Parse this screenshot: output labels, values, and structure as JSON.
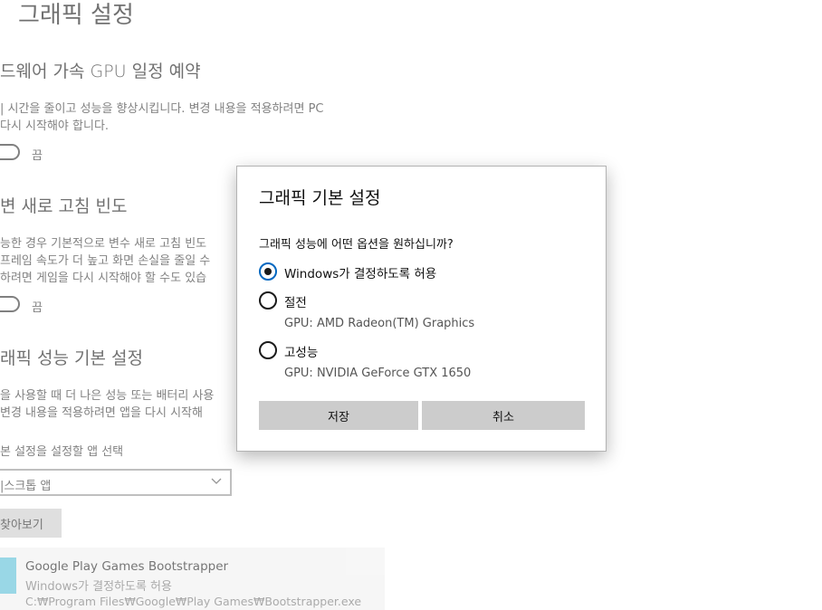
{
  "background": {
    "page_title": "그래픽 설정",
    "hw_section": {
      "title": "드웨어 가속 GPU 일정 예약",
      "desc_line1": "| 시간을 줄이고 성능을 향상시킵니다. 변경 내용을 적용하려면 PC",
      "desc_line2": "다시 시작해야 합니다.",
      "toggle_label": "끔"
    },
    "vrr_section": {
      "title": "변 새로 고침 빈도",
      "desc_line1": "능한 경우 기본적으로 변수 새로 고침 빈도",
      "desc_line2": "프레임 속도가 더 높고 화면 손실을 줄일 수",
      "desc_line3": "하려면 게임을 다시 시작해야 할 수도 있습",
      "toggle_label": "끔"
    },
    "perf_section": {
      "title": "래픽 성능 기본 설정",
      "desc_line1": "을 사용할 때 더 나은 성능 또는 배터리 사용",
      "desc_line2": "변경 내용을 적용하려면 앱을 다시 시작해"
    },
    "app_select_label": "본 설정을 설정할 앱 선택",
    "dropdown_value": "|스크톱 앱",
    "browse_label": "찾아보기",
    "app_card": {
      "name": "Google Play Games Bootstrapper",
      "preference": "Windows가 결정하도록 허용",
      "path": "C:₩Program Files₩Google₩Play Games₩Bootstrapper.exe"
    }
  },
  "dialog": {
    "title": "그래픽 기본 설정",
    "question": "그래픽 성능에 어떤 옵션을 원하십니까?",
    "options": [
      {
        "label": "Windows가 결정하도록 허용",
        "sub": "",
        "selected": true
      },
      {
        "label": "절전",
        "sub": "GPU: AMD Radeon(TM) Graphics",
        "selected": false
      },
      {
        "label": "고성능",
        "sub": "GPU: NVIDIA GeForce GTX 1650",
        "selected": false
      }
    ],
    "save_label": "저장",
    "cancel_label": "취소"
  },
  "colors": {
    "button_bg": "#cccccc",
    "app_icon": "#5bc0d8"
  }
}
